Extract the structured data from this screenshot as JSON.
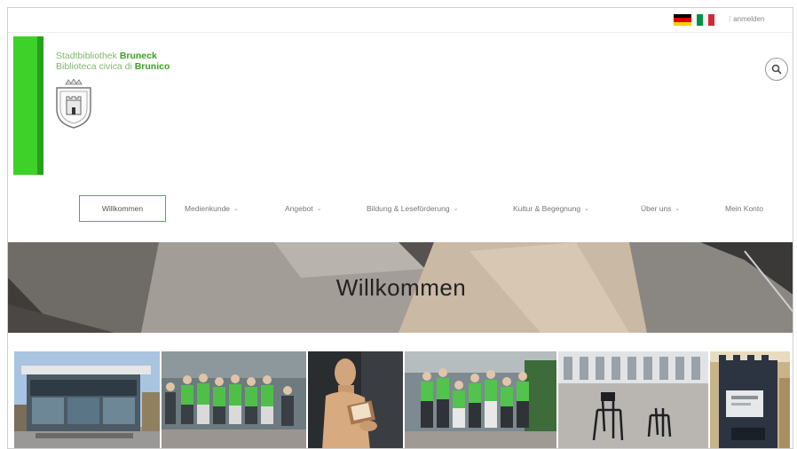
{
  "topbar": {
    "login_label": "anmelden",
    "languages": [
      {
        "name": "Deutsch",
        "icon": "german-flag-icon",
        "colors": [
          "#000000",
          "#dd0000",
          "#ffce00"
        ]
      },
      {
        "name": "Italiano",
        "icon": "italian-flag-icon",
        "colors": [
          "#009246",
          "#ffffff",
          "#ce2b37"
        ]
      }
    ]
  },
  "header": {
    "name_de_prefix": "Stadtbibliothek ",
    "name_de_bold": "Bruneck",
    "name_it_prefix": "Biblioteca civica di ",
    "name_it_bold": "Brunico",
    "accent_color": "#3dd12a",
    "search_icon": "search-icon"
  },
  "nav": {
    "items": [
      {
        "label": "Willkommen",
        "active": true
      },
      {
        "label": "Medienkunde",
        "dropdown": true
      },
      {
        "label": "Angebot",
        "dropdown": true
      },
      {
        "label": "Bildung & Leseförderung",
        "dropdown": true
      },
      {
        "label": "Kultur & Begegnung",
        "dropdown": true
      },
      {
        "label": "Über uns",
        "dropdown": true
      },
      {
        "label": "Mein Konto"
      }
    ]
  },
  "hero": {
    "title": "Willkommen"
  },
  "gallery": {
    "photos": [
      {
        "name": "library-building-photo"
      },
      {
        "name": "group-green-shirts-photo"
      },
      {
        "name": "reading-statue-photo"
      },
      {
        "name": "team-photo"
      },
      {
        "name": "square-chairs-photo"
      },
      {
        "name": "book-return-photo"
      }
    ]
  }
}
